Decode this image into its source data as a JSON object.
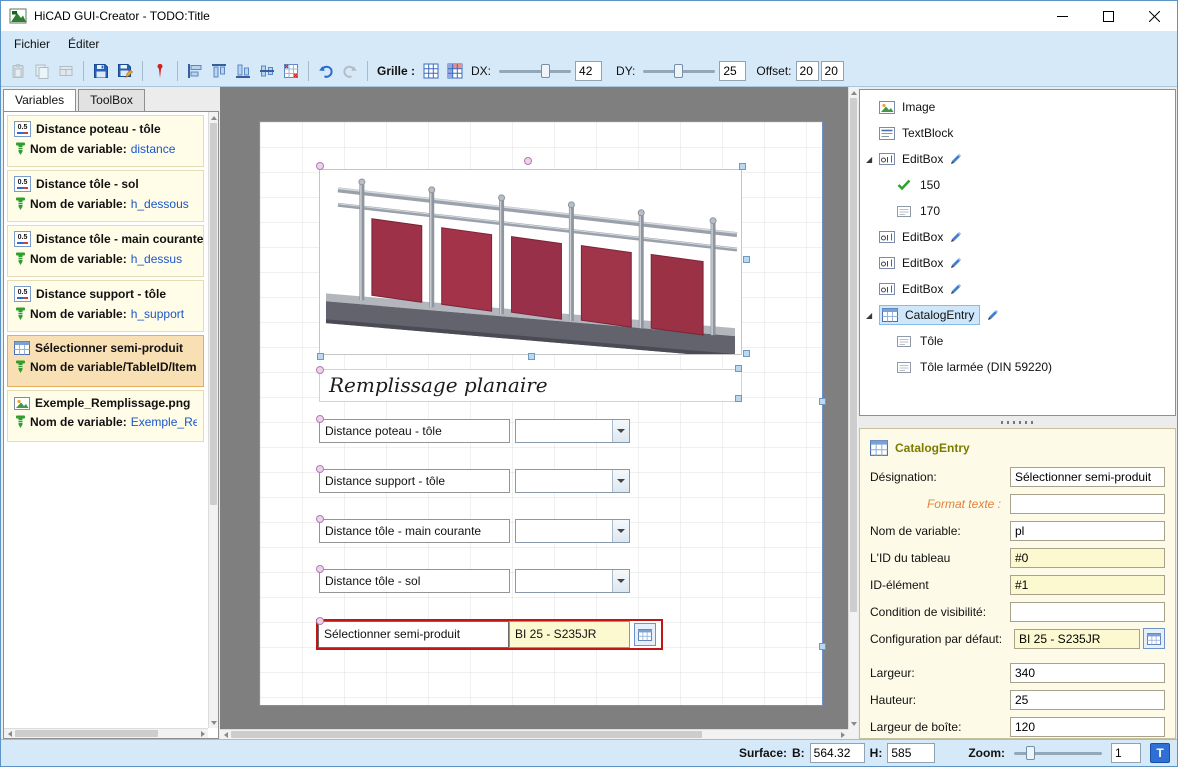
{
  "window": {
    "title": "HiCAD GUI-Creator - TODO:Title"
  },
  "menu": {
    "items": [
      {
        "label": "Fichier"
      },
      {
        "label": "Éditer"
      }
    ]
  },
  "toolbar": {
    "grid_label": "Grille :",
    "dx_label": "DX:",
    "dx_value": "42",
    "dy_label": "DY:",
    "dy_value": "25",
    "offset_label": "Offset:",
    "offset_x": "20",
    "offset_y": "20"
  },
  "left_panel": {
    "tabs": [
      {
        "label": "Variables"
      },
      {
        "label": "ToolBox"
      }
    ],
    "cards": [
      {
        "badge": "0.5",
        "title": "Distance poteau - tôle",
        "line2_label": "Nom de variable: ",
        "line2_value": "distance"
      },
      {
        "badge": "0.5",
        "title": "Distance tôle - sol",
        "line2_label": "Nom de variable: ",
        "line2_value": "h_dessous"
      },
      {
        "badge": "0.5",
        "title": "Distance tôle - main courante",
        "line2_label": "Nom de variable: ",
        "line2_value": "h_dessus"
      },
      {
        "badge": "0.5",
        "title": "Distance support - tôle",
        "line2_label": "Nom de variable: ",
        "line2_value": "h_support"
      },
      {
        "title": "Sélectionner semi-produit",
        "line2_label": "Nom de variable/TableID/ItemID",
        "line2_value": ""
      },
      {
        "title": "Exemple_Remplissage.png",
        "line2_label": "Nom de variable: ",
        "line2_value": "Exemple_Remp"
      }
    ]
  },
  "canvas": {
    "form_title": "Remplissage planaire",
    "rows": [
      {
        "label": "Distance poteau - tôle"
      },
      {
        "label": "Distance support - tôle"
      },
      {
        "label": "Distance tôle - main courante"
      },
      {
        "label": "Distance tôle - sol"
      }
    ],
    "catalog_row": {
      "label": "Sélectionner semi-produit",
      "value": "BI 25 - S235JR"
    }
  },
  "tree": {
    "items": [
      {
        "icon": "image-icon",
        "label": "Image",
        "depth": 0
      },
      {
        "icon": "textblock-icon",
        "label": "TextBlock",
        "depth": 0
      },
      {
        "icon": "editbox-icon",
        "label": "EditBox",
        "depth": 0,
        "expanded": true,
        "pencil": true
      },
      {
        "icon": "check-icon",
        "label": "150",
        "depth": 1
      },
      {
        "icon": "item-icon",
        "label": "170",
        "depth": 1
      },
      {
        "icon": "editbox-icon",
        "label": "EditBox",
        "depth": 0,
        "pencil": true
      },
      {
        "icon": "editbox-icon",
        "label": "EditBox",
        "depth": 0,
        "pencil": true
      },
      {
        "icon": "editbox-icon",
        "label": "EditBox",
        "depth": 0,
        "pencil": true
      },
      {
        "icon": "catalog-icon",
        "label": "CatalogEntry",
        "depth": 0,
        "expanded": true,
        "pencil": true,
        "selected": true
      },
      {
        "icon": "item-icon",
        "label": "Tôle",
        "depth": 1
      },
      {
        "icon": "item-icon",
        "label": "Tôle larmée (DIN 59220)",
        "depth": 1
      }
    ]
  },
  "properties": {
    "header": "CatalogEntry",
    "fields": [
      {
        "label": "Désignation:",
        "value": "Sélectionner semi-produit"
      },
      {
        "label": "Format texte :",
        "value": ""
      },
      {
        "label": "Nom de variable:",
        "value": "pl"
      },
      {
        "label": "L'ID du tableau",
        "value": "#0"
      },
      {
        "label": "ID-élément",
        "value": "#1"
      },
      {
        "label": "Condition de visibilité:",
        "value": ""
      },
      {
        "label": "Configuration par défaut:",
        "value": "BI 25 - S235JR"
      },
      {
        "label": "Largeur:",
        "value": "340"
      },
      {
        "label": "Hauteur:",
        "value": "25"
      },
      {
        "label": "Largeur de boîte:",
        "value": "120"
      }
    ]
  },
  "statusbar": {
    "surface_label": "Surface:",
    "b_label": "B:",
    "b_value": "564.32",
    "h_label": "H:",
    "h_value": "585",
    "zoom_label": "Zoom:",
    "zoom_value": "1",
    "t_button": "T"
  },
  "colors": {
    "chrome_blue": "#d6e9f8",
    "card_yellow": "#fffce8",
    "card_selected_orange": "#f9e0b4",
    "field_yellow": "#fcf9d0",
    "selection_red": "#c41515",
    "tree_selection_blue": "#cfe7fb",
    "panel_maroon": "#9c3147",
    "accent_blue": "#2a6cd0"
  },
  "icon_names": [
    "app-icon",
    "minimize-icon",
    "maximize-icon",
    "close-icon",
    "paste-icon",
    "copy-icon",
    "duplicate-icon",
    "save-icon",
    "save-as-icon",
    "pin-icon",
    "align-left-icon",
    "align-top-icon",
    "align-bottom-icon",
    "align-middle-icon",
    "align-grid-icon",
    "undo-icon",
    "redo-icon",
    "grid-icon",
    "grid-snap-icon",
    "number-format-icon",
    "screw-icon",
    "catalog-icon",
    "image-icon",
    "textblock-icon",
    "editbox-icon",
    "check-icon",
    "item-icon",
    "pencil-icon",
    "dropdown-arrow-icon"
  ]
}
